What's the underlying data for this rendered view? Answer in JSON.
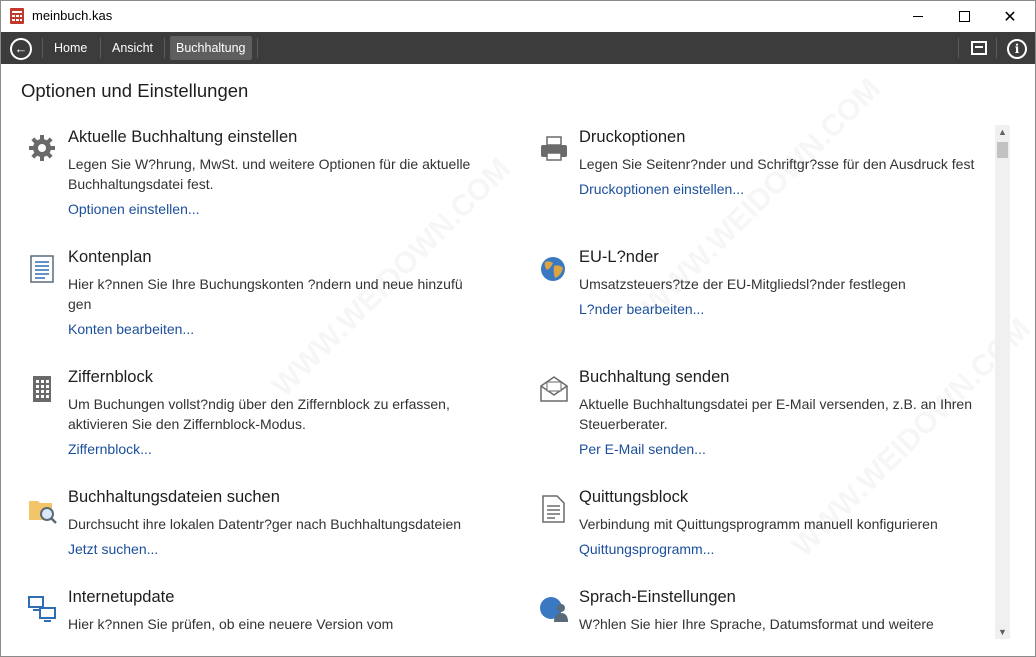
{
  "window": {
    "title": "meinbuch.kas"
  },
  "toolbar": {
    "tabs": [
      "Home",
      "Ansicht",
      "Buchhaltung"
    ],
    "active_tab": "Buchhaltung"
  },
  "page": {
    "title": "Optionen und Einstellungen"
  },
  "items": [
    {
      "id": "aktuelle",
      "icon": "gear-icon",
      "title": "Aktuelle Buchhaltung einstellen",
      "desc": "Legen Sie W?hrung, MwSt. und weitere Optionen für die aktuelle Buchhaltungsdatei fest.",
      "link": "Optionen einstellen..."
    },
    {
      "id": "druck",
      "icon": "printer-icon",
      "title": "Druckoptionen",
      "desc": "Legen Sie Seitenr?nder und Schriftgr?sse für den Ausdruck fest",
      "link": "Druckoptionen einstellen..."
    },
    {
      "id": "kontenplan",
      "icon": "document-list-icon",
      "title": "Kontenplan",
      "desc": "Hier k?nnen Sie Ihre Buchungskonten ?ndern und neue hinzufü gen",
      "link": "Konten bearbeiten..."
    },
    {
      "id": "eu",
      "icon": "globe-icon",
      "title": "EU-L?nder",
      "desc": "Umsatzsteuers?tze der EU-Mitgliedsl?nder festlegen",
      "link": "L?nder bearbeiten..."
    },
    {
      "id": "ziffern",
      "icon": "keypad-icon",
      "title": "Ziffernblock",
      "desc": "Um Buchungen vollst?ndig über den Ziffernblock zu erfassen, aktivieren Sie den Ziffernblock-Modus.",
      "link": "Ziffernblock..."
    },
    {
      "id": "senden",
      "icon": "envelope-icon",
      "title": "Buchhaltung senden",
      "desc": "Aktuelle Buchhaltungsdatei per E-Mail versenden, z.B. an Ihren Steuerberater.",
      "link": "Per E-Mail senden..."
    },
    {
      "id": "suchen",
      "icon": "folder-search-icon",
      "title": "Buchhaltungsdateien suchen",
      "desc": "Durchsucht ihre lokalen Datentr?ger nach Buchhaltungsdateien",
      "link": "Jetzt suchen..."
    },
    {
      "id": "quittung",
      "icon": "receipt-icon",
      "title": "Quittungsblock",
      "desc": "Verbindung mit Quittungsprogramm manuell konfigurieren",
      "link": "Quittungsprogramm..."
    },
    {
      "id": "update",
      "icon": "computers-icon",
      "title": "Internetupdate",
      "desc": "Hier k?nnen Sie prüfen, ob eine neuere Version vom",
      "link": ""
    },
    {
      "id": "sprache",
      "icon": "globe-person-icon",
      "title": "Sprach-Einstellungen",
      "desc": "W?hlen Sie hier Ihre Sprache, Datumsformat und weitere",
      "link": ""
    }
  ]
}
